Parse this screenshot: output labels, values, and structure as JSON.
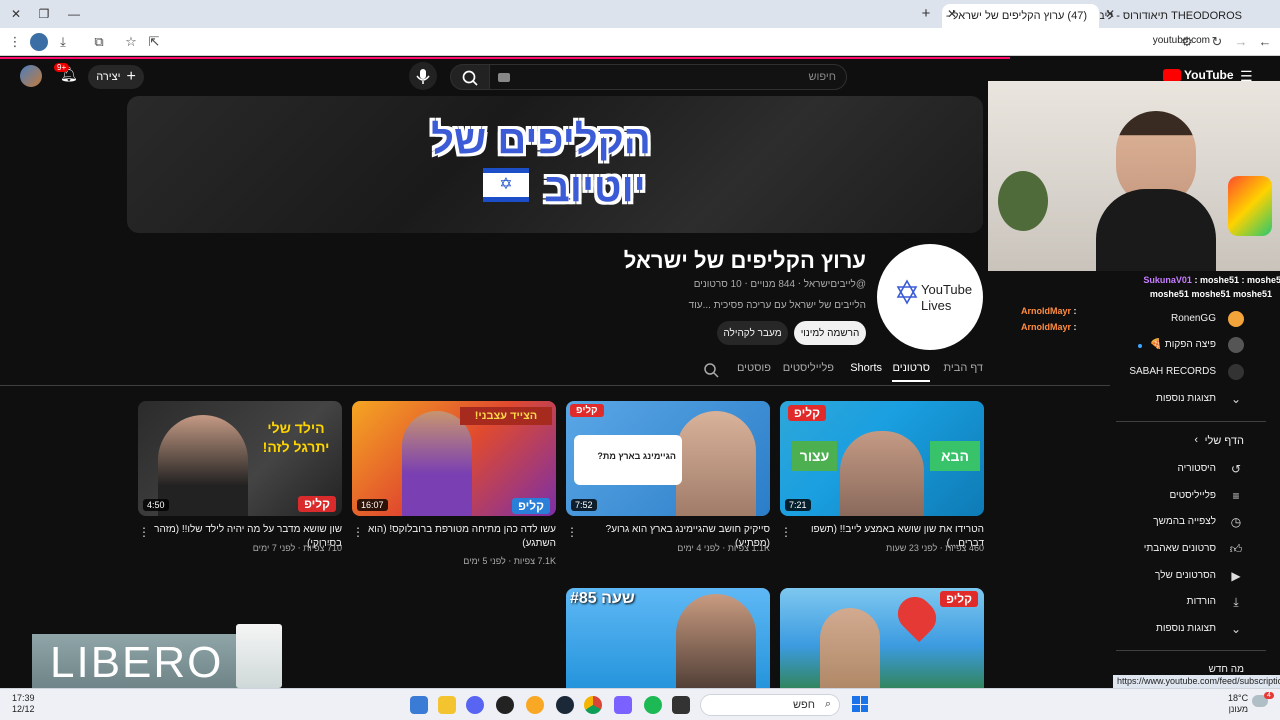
{
  "browser": {
    "tabs": [
      {
        "title": "(47) ערוץ הקליפים של ישראל - ..."
      },
      {
        "title": "THEODOROS תיאודורוס - ליברו..."
      }
    ],
    "new_tab_label": "+",
    "url": "youtube.com"
  },
  "youtube": {
    "logo_text": "YouTube",
    "search_placeholder": "חיפוש",
    "create_label": "יצירה",
    "notifications_badge": "9+"
  },
  "channel": {
    "banner_line1": "הקליפים של",
    "banner_line2": "יוטיוב",
    "avatar_text1": "YouTube",
    "avatar_text2": "Lives",
    "name": "ערוץ הקליפים של ישראל",
    "meta": "@לייביםישראל ‧ 844 מנויים ‧ 10 סרטונים",
    "description": "הלייבים של ישראל עם עריכה פסיכית ...עוד",
    "subscribe_label": "הרשמה למינוי",
    "community_label": "מעבר לקהילה",
    "tabs": [
      "דף הבית",
      "סרטונים",
      "Shorts",
      "פלייליסטים",
      "פוסטים"
    ],
    "selected_tab": "סרטונים"
  },
  "videos": [
    {
      "title": "הטרידו את שון שושא באמצע לייב!! (תשפו דברים...)",
      "views": "460 צפיות",
      "ago": "לפני 23 שעות",
      "duration": "7:21",
      "clip": "קליפ",
      "thumb_text": "הבא  עצור"
    },
    {
      "title": "סייקיק חושב שהגיימינג בארץ הוא גרוע? (מפתיע)",
      "views": "1.1K צפיות",
      "ago": "לפני 4 ימים",
      "duration": "7:52",
      "clip": "קליפ",
      "thumb_text": "הגיימינג בארץ מת?"
    },
    {
      "title": "עשו לדה כהן מתיחה מטורפת ברובלוקס! (הוא השתגע)",
      "views": "7.1K צפיות",
      "ago": "לפני 5 ימים",
      "duration": "16:07",
      "clip": "קליפ",
      "thumb_text": "הצייד עצבני!"
    },
    {
      "title": "שון שושא מדבר על מה יהיה לילד שלו!! (מזהר בסירוקי)",
      "views": "710 צפיות",
      "ago": "לפני 7 ימים",
      "duration": "4:50",
      "clip": "קליפ",
      "thumb_text": "הילד שלי יתרגל לזה!"
    },
    {
      "title": "",
      "views": "",
      "ago": "",
      "duration": "",
      "clip": "קליפ",
      "thumb_text": ""
    },
    {
      "title": "",
      "views": "",
      "ago": "",
      "duration": "",
      "clip": "",
      "thumb_text": "שעה #85"
    }
  ],
  "sidebar": {
    "subscriptions": [
      {
        "label": "RonenGG",
        "icon": "avatar"
      },
      {
        "label": "פיצה הפקות 🍕",
        "icon": "avatar"
      },
      {
        "label": "SABAH RECORDS",
        "icon": "avatar"
      }
    ],
    "show_more_1": "תצוגות נוספות",
    "my_page_header": "הדף שלי",
    "items": [
      {
        "label": "היסטוריה",
        "icon": "history-icon"
      },
      {
        "label": "פלייליסטים",
        "icon": "playlist-icon"
      },
      {
        "label": "לצפייה בהמשך",
        "icon": "clock-icon"
      },
      {
        "label": "סרטונים שאהבתי",
        "icon": "like-icon"
      },
      {
        "label": "הסרטונים שלך",
        "icon": "video-icon"
      },
      {
        "label": "הורדות",
        "icon": "download-icon"
      }
    ],
    "show_more_2": "תצוגות נוספות",
    "whats_new": "מה חדש"
  },
  "chat": [
    {
      "user": "SukunaV01",
      "text": "moshe51 : moshe51",
      "color": "#c77dff"
    },
    {
      "user": "moshe51",
      "text": "moshe51 moshe51",
      "color": "#ffffff"
    },
    {
      "user": "ArnoldMayr",
      "text": ":",
      "color": "#ff8c42"
    },
    {
      "user": "ArnoldMayr",
      "text": ":",
      "color": "#ff8c42"
    }
  ],
  "overlay": {
    "product_text": "LIBERO"
  },
  "taskbar": {
    "search_label": "חפש",
    "weather_temp": "18°C",
    "weather_desc": "מעונן",
    "time": "17:39",
    "date": "12/12",
    "status_url": "https://www.youtube.com/feed/subscriptions",
    "badge": "4"
  }
}
